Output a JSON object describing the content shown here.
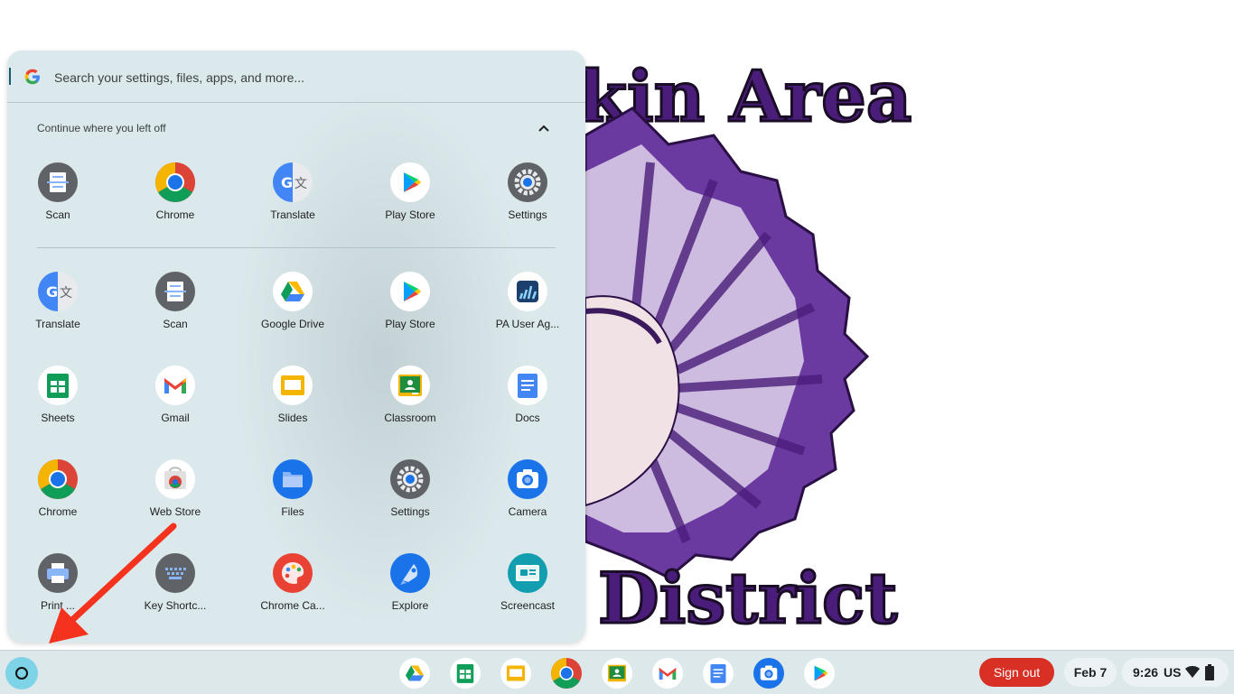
{
  "wallpaper": {
    "top_text": "kin Area",
    "bottom_text": "District",
    "colors": {
      "purple": "#4b1d7a",
      "outline": "#1a0d26"
    }
  },
  "launcher": {
    "search_placeholder": "Search your settings, files, apps, and more...",
    "continue_header": "Continue where you left off",
    "recent_apps": [
      {
        "label": "Scan",
        "icon": "scan-icon"
      },
      {
        "label": "Chrome",
        "icon": "chrome-icon"
      },
      {
        "label": "Translate",
        "icon": "translate-icon"
      },
      {
        "label": "Play Store",
        "icon": "play-store-icon"
      },
      {
        "label": "Settings",
        "icon": "settings-icon"
      }
    ],
    "apps": [
      {
        "label": "Translate",
        "icon": "translate-icon"
      },
      {
        "label": "Scan",
        "icon": "scan-icon"
      },
      {
        "label": "Google Drive",
        "icon": "drive-icon"
      },
      {
        "label": "Play Store",
        "icon": "play-store-icon"
      },
      {
        "label": "PA User Ag...",
        "icon": "pa-user-agreement-icon"
      },
      {
        "label": "Sheets",
        "icon": "sheets-icon"
      },
      {
        "label": "Gmail",
        "icon": "gmail-icon"
      },
      {
        "label": "Slides",
        "icon": "slides-icon"
      },
      {
        "label": "Classroom",
        "icon": "classroom-icon"
      },
      {
        "label": "Docs",
        "icon": "docs-icon"
      },
      {
        "label": "Chrome",
        "icon": "chrome-icon"
      },
      {
        "label": "Web Store",
        "icon": "web-store-icon"
      },
      {
        "label": "Files",
        "icon": "files-icon"
      },
      {
        "label": "Settings",
        "icon": "settings-icon"
      },
      {
        "label": "Camera",
        "icon": "camera-icon"
      },
      {
        "label": "Print ...",
        "icon": "print-icon"
      },
      {
        "label": "Key Shortc...",
        "icon": "key-shortcuts-icon"
      },
      {
        "label": "Chrome Ca...",
        "icon": "chrome-canvas-icon"
      },
      {
        "label": "Explore",
        "icon": "explore-icon"
      },
      {
        "label": "Screencast",
        "icon": "screencast-icon"
      }
    ]
  },
  "shelf": {
    "pinned": [
      {
        "icon": "drive-icon"
      },
      {
        "icon": "sheets-icon"
      },
      {
        "icon": "slides-icon"
      },
      {
        "icon": "chrome-icon"
      },
      {
        "icon": "classroom-icon"
      },
      {
        "icon": "gmail-icon"
      },
      {
        "icon": "docs-icon"
      },
      {
        "icon": "camera-icon"
      },
      {
        "icon": "play-store-icon"
      }
    ],
    "sign_out_label": "Sign out",
    "date": "Feb 7",
    "time": "9:26",
    "input_method": "US",
    "accent": "#d93025"
  }
}
